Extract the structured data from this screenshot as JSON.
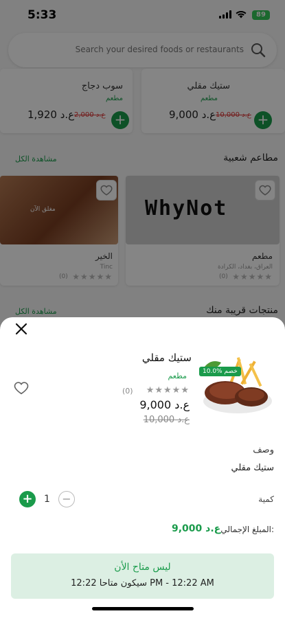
{
  "status": {
    "time": "5:33",
    "battery": "89"
  },
  "search": {
    "placeholder": "Search your desired foods or restaurants"
  },
  "offers": [
    {
      "name": "سوب دجاج",
      "category": "مطعم",
      "price": "ع.د 1,920",
      "old_price": "ع.د 2,000"
    },
    {
      "name": "ستيك مقلي",
      "category": "مطعم",
      "price": "ع.د 9,000",
      "old_price": "ع.د 10,000"
    }
  ],
  "popular": {
    "title": "مطاعم شعبية",
    "see_all": "مشاهدة الكل",
    "items": [
      {
        "name": "الخير",
        "address": "Tinc",
        "rating_count": "(0)",
        "badge": "مغلق الآن"
      },
      {
        "name": "مطعم",
        "address": "العراق، بغداد، الكرادة",
        "rating_count": "(0)",
        "logo_text": "WhyNot"
      }
    ]
  },
  "nearby": {
    "title": "منتجات قريبة منك",
    "see_all": "مشاهدة الكل"
  },
  "sheet": {
    "product_name": "ستيك مقلي",
    "category": "مطعم",
    "rating_count": "(0)",
    "price": "ع.د 9,000",
    "old_price": "ع.د 10,000",
    "discount": "10.0% خصم",
    "description_label": "وصف",
    "description": "ستيك مقلي",
    "quantity_label": "كمية",
    "quantity": "1",
    "total_label": "المبلغ الإجمالي:",
    "total": "ع.د 9,000",
    "notice_title": "ليس متاح الأن",
    "notice_sub": "سيكون متاحا 12:22 PM - 12:22 AM"
  },
  "colors": {
    "accent": "#1a9b4b",
    "overlay": "rgba(0,0,0,0.48)"
  }
}
